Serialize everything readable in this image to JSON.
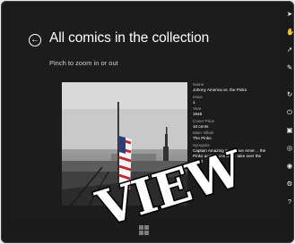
{
  "page": {
    "title": "All comics in the collection",
    "subtitle": "Pinch to zoom in or out"
  },
  "details": [
    {
      "key": "Name",
      "value": "Johnny America vs. the Pinko"
    },
    {
      "key": "Issue",
      "value": "1"
    },
    {
      "key": "Year",
      "value": "1949"
    },
    {
      "key": "Cover Price",
      "value": "10 cents"
    },
    {
      "key": "Main Villain",
      "value": "The Pinko"
    },
    {
      "key": "Synopsis",
      "value": "Captain Amazing must save Amer… the Pinko and his cronies… take over the world"
    }
  ],
  "overlay": {
    "text": "VIEW"
  },
  "charms": [
    "pointer-icon",
    "hand-icon",
    "arrow-icon",
    "paint-icon",
    "refresh-icon",
    "power-icon",
    "monitor-icon",
    "globe-icon",
    "camera-icon",
    "gear-icon",
    "help-icon"
  ],
  "colors": {
    "screen_bg": "#1c1c1c",
    "text": "#ffffff",
    "muted": "#a8a8a8",
    "flag_red": "#c0282d",
    "flag_blue": "#2c3e7a"
  }
}
